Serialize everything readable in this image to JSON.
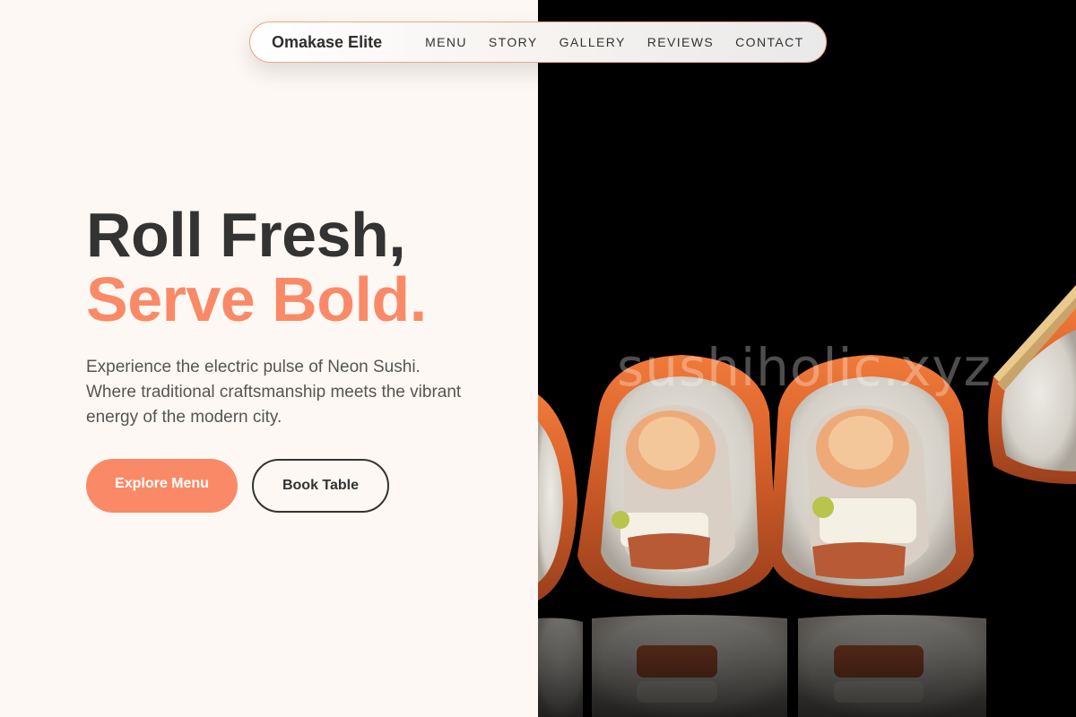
{
  "nav": {
    "brand": "Omakase Elite",
    "links": [
      "MENU",
      "STORY",
      "GALLERY",
      "REVIEWS",
      "CONTACT"
    ]
  },
  "hero": {
    "title_line1": "Roll Fresh,",
    "title_line2": "Serve Bold.",
    "description": "Experience the electric pulse of Neon Sushi. Where traditional craftsmanship meets the vibrant energy of the modern city.",
    "primary_button": "Explore Menu",
    "secondary_button": "Book Table"
  },
  "image": {
    "watermark": "sushiholic.xyz",
    "subject": "sushi-rolls-photo"
  },
  "colors": {
    "accent": "#fa8a67",
    "dark_text": "#333333",
    "background": "#fdf8f3",
    "photo_background": "#000000"
  }
}
